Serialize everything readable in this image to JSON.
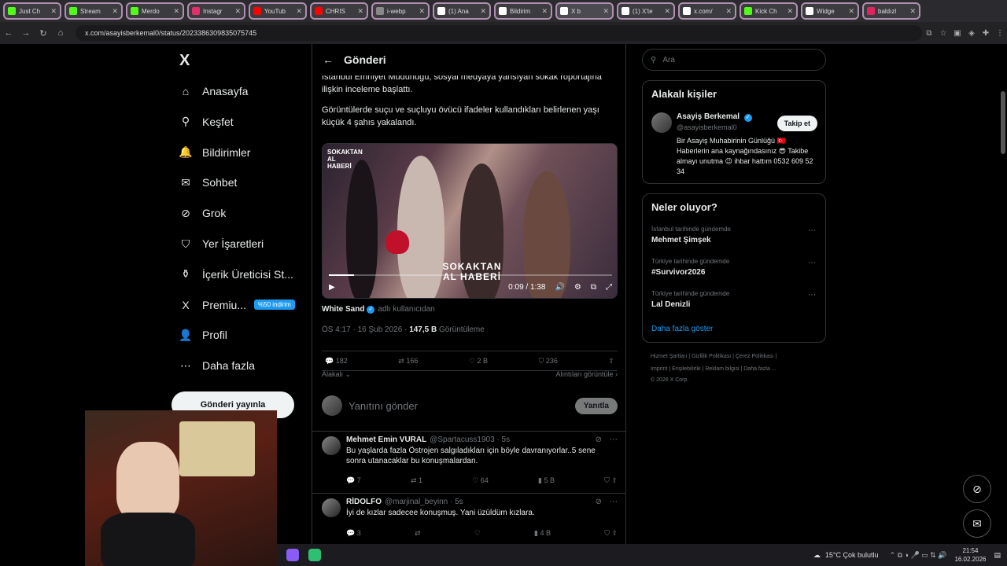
{
  "browser": {
    "tabs": [
      {
        "label": "Just Ch",
        "color": "#53fc18"
      },
      {
        "label": "Stream",
        "color": "#53fc18"
      },
      {
        "label": "Merdo",
        "color": "#53fc18"
      },
      {
        "label": "Instagr",
        "color": "#e1306c"
      },
      {
        "label": "YouTub",
        "color": "#ff0000"
      },
      {
        "label": "CHRIS",
        "color": "#ff0000"
      },
      {
        "label": "i-webp",
        "color": "#888888"
      },
      {
        "label": "(1) Ana",
        "color": "#ffffff"
      },
      {
        "label": "Bildirim",
        "color": "#ffffff"
      },
      {
        "label": "X b",
        "color": "#ffffff"
      },
      {
        "label": "(1) X'te",
        "color": "#ffffff"
      },
      {
        "label": "x.com/",
        "color": "#ffffff"
      },
      {
        "label": "Kick Ch",
        "color": "#53fc18"
      },
      {
        "label": "Widge",
        "color": "#ffffff"
      },
      {
        "label": "baldızl",
        "color": "#e0245e"
      }
    ],
    "url": "x.com/asayisberkemal0/status/2023386309835075745"
  },
  "sidebar": {
    "logo": "X",
    "items": [
      {
        "label": "Anasayfa",
        "icon": "home-icon",
        "glyph": "⌂"
      },
      {
        "label": "Keşfet",
        "icon": "search-icon",
        "glyph": "⚲"
      },
      {
        "label": "Bildirimler",
        "icon": "bell-icon",
        "glyph": "🔔"
      },
      {
        "label": "Sohbet",
        "icon": "mail-icon",
        "glyph": "✉"
      },
      {
        "label": "Grok",
        "icon": "grok-icon",
        "glyph": "⊘"
      },
      {
        "label": "Yer İşaretleri",
        "icon": "bookmark-icon",
        "glyph": "⛉"
      },
      {
        "label": "İçerik Üreticisi St...",
        "icon": "creator-icon",
        "glyph": "⚱"
      },
      {
        "label": "Premiu...",
        "icon": "x-premium-icon",
        "glyph": "X"
      },
      {
        "label": "Profil",
        "icon": "person-icon",
        "glyph": "👤"
      },
      {
        "label": "Daha fazla",
        "icon": "more-icon",
        "glyph": "⋯"
      }
    ],
    "premium_badge": "%50 indirim",
    "post_button": "Gönderi yayınla"
  },
  "feed": {
    "title": "Gönderi",
    "text_top": "İstanbul Emniyet Müdürlüğü, sosyal medyaya yansıyan sokak röportajına ilişkin inceleme başlattı.",
    "text_second": "Görüntülerde suçu ve suçluyu övücü ifadeler kullandıkları belirlenen yaşı küçük 4 şahıs yakalandı.",
    "video": {
      "brand": "SOKAKTAN AL HABERİ",
      "watermark": "SOKAKTAN AL HABERİ",
      "time": "0:09 / 1:38",
      "progress": 0.09
    },
    "credit_name": "White Sand",
    "credit_suffix": "adlı kullanıcıdan",
    "meta_time": "ÖS 4:17 · 16 Şub 2026 ·",
    "views_count": "147,5 B",
    "views_label": "Görüntüleme",
    "actions": {
      "replies": "182",
      "reposts": "166",
      "likes": "2 B",
      "bookmarks": "236"
    },
    "relevancy": "Alakalı",
    "quotes_link": "Alıntıları görüntüle",
    "reply_placeholder": "Yanıtını gönder",
    "reply_button": "Yanıtla",
    "comments": [
      {
        "name": "Mehmet Emin VURAL",
        "handle": "@Spartacuss1903 · 5s",
        "text": "Bu yaşlarda fazla Östrojen salgıladıkları için böyle davranıyorlar..5 sene sonra utanacaklar bu konuşmalardan.",
        "replies": "7",
        "reposts": "1",
        "likes": "64",
        "views": "5 B"
      },
      {
        "name": "RİDOLFO",
        "handle": "@marjinal_beyinn · 5s",
        "text": "İyi de kızlar sadecee konuşmuş. Yani üzüldüm kızlara.",
        "replies": "3",
        "reposts": "",
        "likes": "",
        "views": "4 B"
      }
    ]
  },
  "right": {
    "search_placeholder": "Ara",
    "people_title": "Alakalı kişiler",
    "person": {
      "name": "Asayiş Berkemal",
      "handle": "@asayisberkemal0",
      "follow": "Takip et",
      "bio": "Bir Asayiş Muhabirinin Günlüğü 🇹🇷 Haberlerin ana kaynağındasınız 😎 Takibe almayı unutma 😉 ihbar hattım 0532 609 52 34"
    },
    "trends_title": "Neler oluyor?",
    "trends": [
      {
        "category": "İstanbul tarihinde gündemde",
        "name": "Mehmet Şimşek"
      },
      {
        "category": "Türkiye tarihinde gündemde",
        "name": "#Survivor2026"
      },
      {
        "category": "Türkiye tarihinde gündemde",
        "name": "Lal Denizli"
      }
    ],
    "show_more": "Daha fazla göster",
    "footer_line1": "Hizmet Şartları  |  Gizlilik Politikası  |  Çerez Politikası  |",
    "footer_line2": "Imprint  |  Erişilebilirlik  |  Reklam bilgisi  |  Daha fazla ...",
    "footer_line3": "© 2026 X Corp."
  },
  "taskbar": {
    "weather": "15°C  Çok bulutlu",
    "time": "21:54",
    "date": "16.02.2026"
  }
}
